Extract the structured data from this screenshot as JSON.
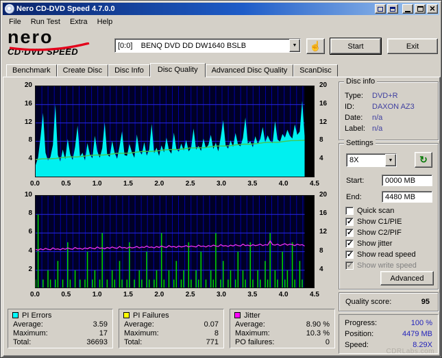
{
  "window": {
    "title": "Nero CD-DVD Speed 4.7.0.0"
  },
  "menu": {
    "items": [
      "File",
      "Run Test",
      "Extra",
      "Help"
    ]
  },
  "toolbar": {
    "logo_main": "nero",
    "logo_sub": "CD·DVD SPEED",
    "drive_select": "[0:0]    BENQ DVD DD DW1640 BSLB",
    "start_label": "Start",
    "exit_label": "Exit"
  },
  "tabs": {
    "items": [
      "Benchmark",
      "Create Disc",
      "Disc Info",
      "Disc Quality",
      "Advanced Disc Quality",
      "ScanDisc"
    ],
    "active_index": 3
  },
  "disc_info": {
    "title": "Disc info",
    "rows": [
      [
        "Type:",
        "DVD+R"
      ],
      [
        "ID:",
        "DAXON AZ3"
      ],
      [
        "Date:",
        "n/a"
      ],
      [
        "Label:",
        "n/a"
      ]
    ]
  },
  "settings": {
    "title": "Settings",
    "speed_value": "8X",
    "start_label": "Start:",
    "start_value": "0000 MB",
    "end_label": "End:",
    "end_value": "4480 MB",
    "checkboxes": [
      {
        "label": "Quick scan",
        "checked": false,
        "enabled": true
      },
      {
        "label": "Show C1/PIE",
        "checked": true,
        "enabled": true
      },
      {
        "label": "Show C2/PIF",
        "checked": true,
        "enabled": true
      },
      {
        "label": "Show jitter",
        "checked": true,
        "enabled": true
      },
      {
        "label": "Show read speed",
        "checked": true,
        "enabled": true
      },
      {
        "label": "Show write speed",
        "checked": true,
        "enabled": false
      }
    ],
    "advanced_label": "Advanced"
  },
  "quality": {
    "label": "Quality score:",
    "value": "95"
  },
  "progress": {
    "rows": [
      [
        "Progress:",
        "100 %"
      ],
      [
        "Position:",
        "4479 MB"
      ],
      [
        "Speed:",
        "8.29X"
      ]
    ]
  },
  "stats": [
    {
      "title": "PI Errors",
      "swatch": "#00ffff",
      "rows": [
        [
          "Average:",
          "3.59"
        ],
        [
          "Maximum:",
          "17"
        ],
        [
          "Total:",
          "36693"
        ]
      ]
    },
    {
      "title": "PI Failures",
      "swatch": "#ffff00",
      "rows": [
        [
          "Average:",
          "0.07"
        ],
        [
          "Maximum:",
          "8"
        ],
        [
          "Total:",
          "771"
        ]
      ]
    },
    {
      "title": "Jitter",
      "swatch": "#ff00ff",
      "rows": [
        [
          "Average:",
          "8.90 %"
        ],
        [
          "Maximum:",
          "10.3 %"
        ],
        [
          "PO failures:",
          "0"
        ]
      ]
    }
  ],
  "watermark": {
    "text": "CDRLabs.com"
  },
  "charts": {
    "x_ticks": [
      "0.0",
      "0.5",
      "1.0",
      "1.5",
      "2.0",
      "2.5",
      "3.0",
      "3.5",
      "4.0",
      "4.5"
    ],
    "x_max": 4.5,
    "data_end": 4.33,
    "colors": {
      "plot_bg": "#000026",
      "grid_minor": "#0000a8",
      "grid_major": "#2828e8",
      "pi_errors": "#00f0f0",
      "read_speed": "#46c850",
      "pi_failures": "#00d200",
      "jitter": "#f030f0",
      "end_band": "#000000"
    },
    "top": {
      "y_left_ticks": [
        20,
        16,
        12,
        8,
        4
      ],
      "y_left_max": 20,
      "y_right_ticks": [
        20,
        16,
        12,
        8,
        4
      ],
      "y_right_max": 20,
      "pi_errors": [
        2.8,
        4.5,
        9.0,
        14.2,
        5.5,
        3.8,
        4.6,
        7.2,
        16.1,
        5.0,
        3.6,
        6.2,
        4.1,
        8.5,
        5.2,
        3.9,
        6.8,
        11.4,
        4.7,
        5.5,
        3.8,
        7.6,
        5.1,
        4.3,
        9.2,
        5.8,
        4.4,
        6.5,
        12.1,
        5.2,
        4.6,
        8.1,
        5.5,
        4.2,
        6.9,
        10.2,
        5.0,
        4.8,
        7.4,
        5.6,
        4.4,
        9.5,
        5.9,
        5.1,
        7.8,
        4.9,
        6.2,
        11.8,
        5.4,
        6.6,
        4.8,
        7.1,
        5.6,
        8.8,
        6.1,
        5.3,
        9.9,
        6.4,
        5.7,
        7.5,
        6.0,
        8.3,
        5.8,
        6.6,
        10.8,
        6.2,
        7.0,
        5.9,
        8.6,
        6.5,
        7.2,
        9.4,
        6.3,
        7.7,
        5.8,
        8.9,
        12.6,
        7.1,
        6.4,
        8.2,
        6.8,
        9.8,
        7.3,
        6.9,
        8.7,
        13.2,
        7.5,
        8.0,
        6.7,
        9.1,
        7.4,
        8.5,
        11.1,
        7.8,
        9.3,
        8.1,
        7.6,
        12.4,
        8.4,
        7.9,
        9.6,
        8.8,
        10.5,
        9.2,
        8.6,
        11.7,
        9.4,
        10.1,
        16.8,
        9.0
      ],
      "read_speed": {
        "start": 4.0,
        "end": 8.29
      }
    },
    "bottom": {
      "y_left_ticks": [
        10,
        8,
        6,
        4,
        2
      ],
      "y_left_max": 10,
      "y_right_ticks": [
        20,
        16,
        12,
        8,
        4
      ],
      "y_right_max": 20,
      "pi_failures": [
        1,
        8,
        0,
        1,
        0,
        2,
        1,
        0,
        1,
        3,
        0,
        1,
        0,
        5,
        1,
        0,
        2,
        0,
        1,
        0,
        1,
        4,
        0,
        1,
        2,
        0,
        1,
        6,
        0,
        1,
        0,
        2,
        1,
        0,
        3,
        1,
        0,
        1,
        5,
        0,
        1,
        0,
        2,
        1,
        0,
        4,
        1,
        0,
        1,
        2,
        0,
        6,
        1,
        0,
        2,
        0,
        1,
        3,
        0,
        1,
        2,
        0,
        5,
        1,
        0,
        2,
        1,
        4,
        0,
        1,
        0,
        2,
        1,
        6,
        0,
        1,
        3,
        0,
        1,
        2,
        0,
        1,
        4,
        0,
        2,
        1,
        0,
        5,
        1,
        0,
        2,
        1,
        0,
        3,
        1,
        6,
        0,
        2,
        1,
        0,
        4,
        1,
        2,
        0,
        5,
        1,
        0,
        3,
        1,
        0
      ],
      "jitter": [
        8.5,
        8.3,
        8.6,
        8.4,
        8.7,
        8.5,
        8.4,
        8.8,
        8.5,
        8.6,
        8.4,
        8.7,
        8.5,
        8.8,
        8.6,
        8.5,
        8.9,
        8.6,
        8.7,
        8.5,
        8.8,
        8.6,
        8.9,
        8.7,
        8.6,
        9.0,
        8.7,
        8.8,
        8.6,
        8.9,
        8.7,
        9.0,
        8.8,
        8.7,
        9.1,
        8.8,
        8.9,
        8.7,
        9.0,
        8.8,
        8.9,
        9.1,
        8.8,
        9.0,
        8.9,
        9.2,
        8.9,
        9.0,
        8.8,
        9.1,
        8.9,
        9.2,
        9.0,
        8.9,
        9.3,
        9.0,
        9.1,
        8.9,
        9.2,
        9.0,
        9.1,
        9.3,
        9.0,
        9.2,
        9.1,
        9.0,
        9.4,
        9.1,
        9.2,
        9.0,
        9.3,
        9.1,
        9.4,
        9.2,
        9.1,
        9.5,
        9.2,
        9.3,
        9.1,
        9.4,
        9.2,
        9.5,
        9.3,
        9.2,
        9.6,
        9.3,
        9.4,
        9.2,
        9.5,
        9.3,
        9.4,
        9.6,
        9.3,
        9.5,
        9.4,
        10.3,
        9.5,
        9.4,
        9.6,
        9.3,
        9.5,
        9.7,
        9.4,
        9.6,
        9.5,
        9.3,
        9.6,
        9.4,
        9.5,
        9.2
      ]
    }
  }
}
